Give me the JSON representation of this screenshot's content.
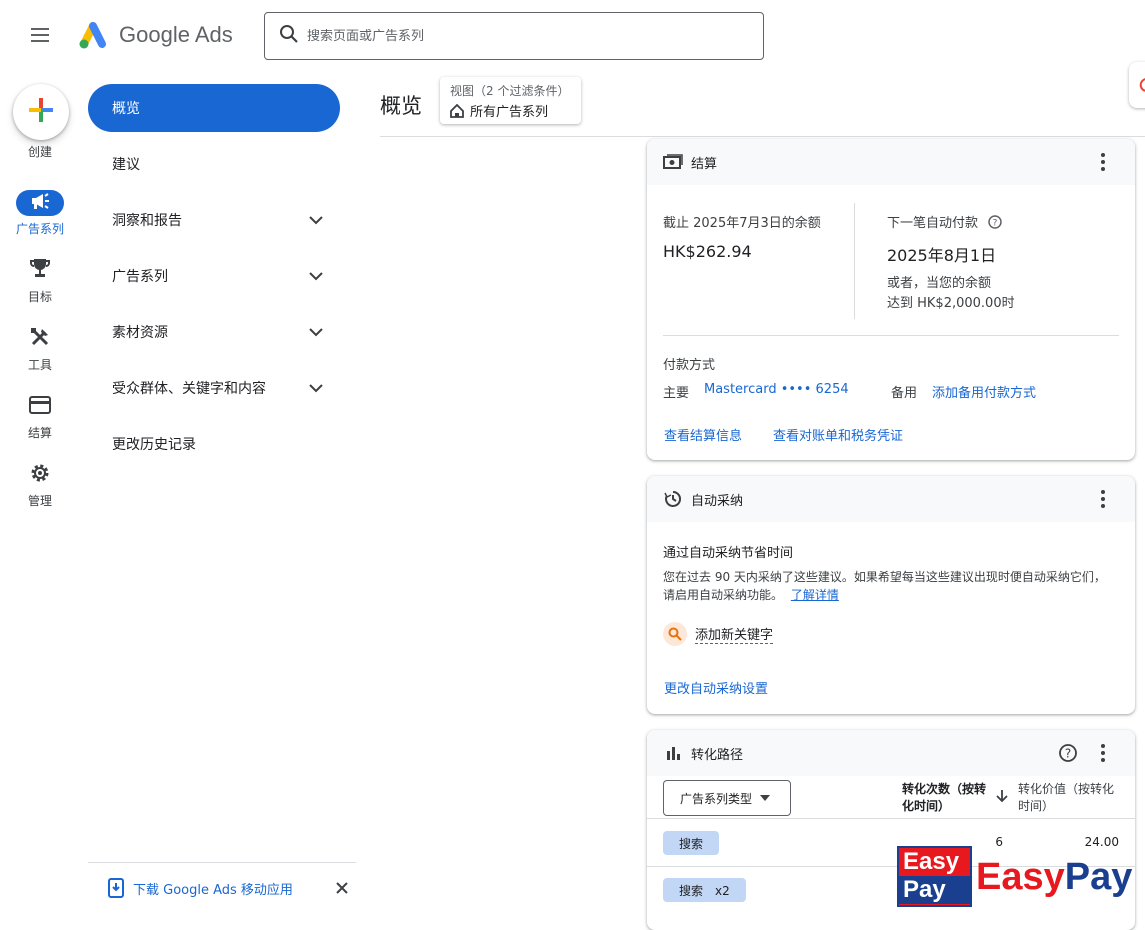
{
  "header": {
    "app_name": "Google Ads",
    "search_placeholder": "搜索页面或广告系列"
  },
  "rail": {
    "create_label": "创建",
    "items": [
      {
        "label": "广告系列",
        "icon": "megaphone-icon",
        "active": true
      },
      {
        "label": "目标",
        "icon": "trophy-icon"
      },
      {
        "label": "工具",
        "icon": "tools-icon"
      },
      {
        "label": "结算",
        "icon": "credit-card-icon"
      },
      {
        "label": "管理",
        "icon": "gear-icon"
      }
    ]
  },
  "nav": {
    "items": [
      {
        "label": "概览",
        "active": true
      },
      {
        "label": "建议"
      },
      {
        "label": "洞察和报告",
        "expandable": true
      },
      {
        "label": "广告系列",
        "expandable": true
      },
      {
        "label": "素材资源",
        "expandable": true
      },
      {
        "label": "受众群体、关键字和内容",
        "expandable": true
      },
      {
        "label": "更改历史记录"
      }
    ],
    "download_label": "下载 Google Ads 移动应用"
  },
  "main": {
    "title": "概览",
    "view_chip": {
      "line1": "视图（2 个过滤条件）",
      "line2": "所有广告系列"
    }
  },
  "billing_card": {
    "title": "结算",
    "balance_label": "截止 2025年7月3日的余额",
    "balance_value": "HK$262.94",
    "next_payment_label": "下一笔自动付款",
    "next_payment_date": "2025年8月1日",
    "threshold_line1": "或者，当您的余额",
    "threshold_line2": "达到 HK$2,000.00时",
    "payment_method_label": "付款方式",
    "primary_label": "主要",
    "primary_value": "Mastercard •••• 6254",
    "backup_label": "备用",
    "backup_link": "添加备用付款方式",
    "link_billing_info": "查看结算信息",
    "link_statements": "查看对账单和税务凭证"
  },
  "auto_apply_card": {
    "title": "自动采纳",
    "heading": "通过自动采纳节省时间",
    "desc_line1": "您在过去 90 天内采纳了这些建议。如果希望每当这些建议出现时便自动采纳它们，",
    "desc_line2": "请启用自动采纳功能。",
    "learn_more": "了解详情",
    "suggestion": "添加新关键字",
    "settings_link": "更改自动采纳设置"
  },
  "conversion_card": {
    "title": "转化路径",
    "filter_label": "广告系列类型",
    "col1_line1": "转化次数（按转",
    "col1_line2": "化时间）",
    "col2_line1": "转化价值（按转化",
    "col2_line2": "时间）",
    "rows": [
      {
        "label": "搜索",
        "conversions": "6",
        "value": "24.00"
      },
      {
        "label": "搜索　x2",
        "conversions": "",
        "value": ""
      }
    ]
  },
  "watermark": {
    "box_top": "Easy",
    "box_bottom": "Pay",
    "text_easy": "Easy",
    "text_pay": "Pay"
  },
  "colors": {
    "accent": "#1967d2",
    "chip": "#c2d7f5",
    "watermark_red": "#e7191f",
    "watermark_blue": "#1b3f8f"
  }
}
